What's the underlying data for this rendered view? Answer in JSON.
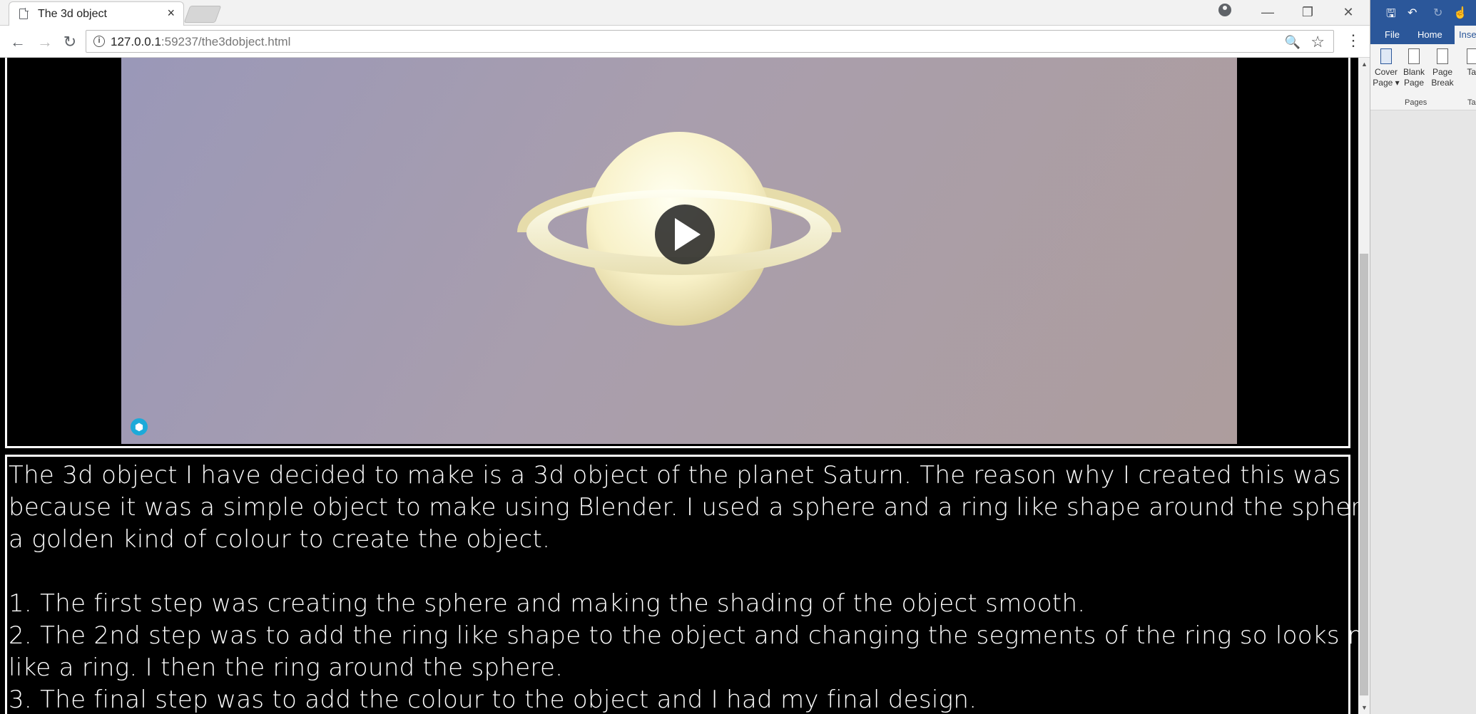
{
  "browser": {
    "tab_title": "The 3d object",
    "tab_close": "×",
    "url_host": "127.0.0.1",
    "url_port": ":59237",
    "url_path": "/the3dobject.html",
    "window_minimize": "—",
    "window_restore": "❐",
    "window_close": "✕",
    "back": "←",
    "forward": "→",
    "reload": "↻",
    "zoom_glyph": "🔍",
    "star_glyph": "☆",
    "menu_glyph": "⋮",
    "info_glyph": "i"
  },
  "viewer": {
    "play_button": "play-button",
    "brand_glyph": "⬢",
    "sky_colors": [
      "#9a98b8",
      "#ad9d9d"
    ],
    "planet_color": "#fffbd6"
  },
  "article": {
    "paragraph_lines": [
      "The 3d object I have decided to make is a 3d object of the planet Saturn. The reason why I created this was",
      "because it was a simple object to make using Blender. I used a sphere and a ring like shape around the sphere with",
      "a golden kind of colour to create the object."
    ],
    "steps": [
      "1. The first step was creating the sphere and making the shading of the object smooth.",
      "2. The 2nd step was to add the ring like shape to the object and changing the segments of the ring so looks more",
      "like a ring. I then the ring around the sphere.",
      "3. The final step was to add the colour to the object and I had my final design."
    ]
  },
  "word": {
    "tabs": [
      "File",
      "Home",
      "Inser"
    ],
    "qat_save": "🖫",
    "qat_undo": "↶",
    "qat_redo": "↻",
    "buttons": [
      {
        "line1": "Cover",
        "line2": "Page ▾"
      },
      {
        "line1": "Blank",
        "line2": "Page"
      },
      {
        "line1": "Page",
        "line2": "Break"
      },
      {
        "line1": "Tal",
        "line2": ""
      }
    ],
    "group_label": "Pages",
    "group_label_2": "Tab"
  },
  "colors": {
    "word_blue": "#2b579a",
    "page_bg": "#000000"
  }
}
